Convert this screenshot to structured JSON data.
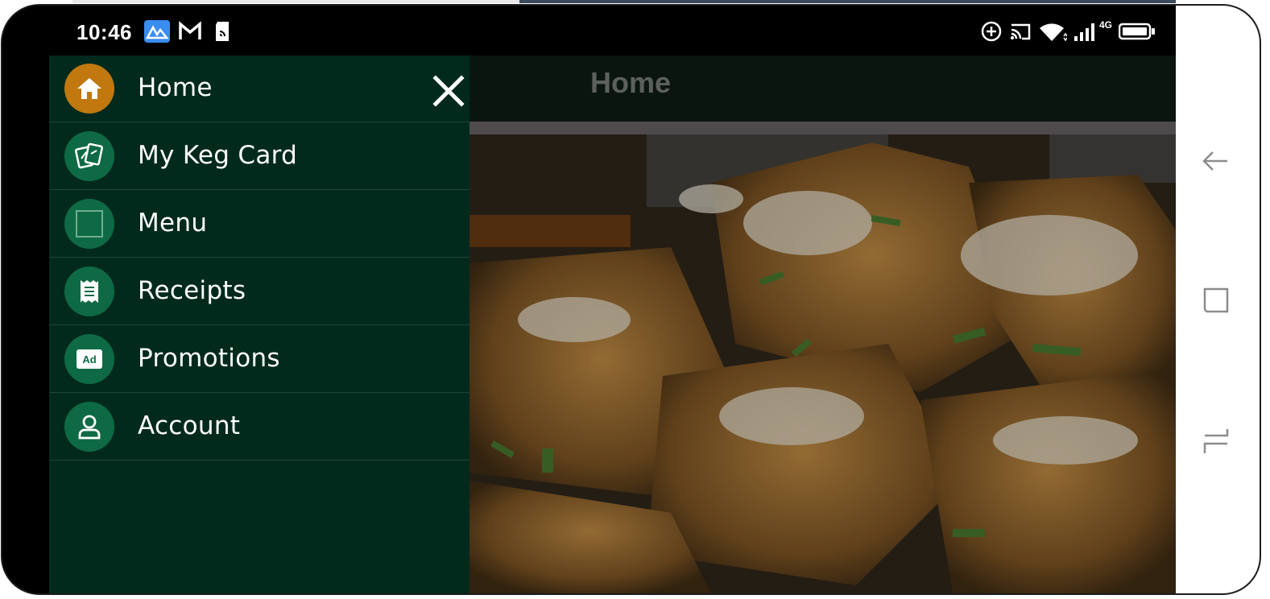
{
  "status_bar": {
    "time": "10:46",
    "left_icons": [
      "maps-app-icon",
      "gmail-icon",
      "sd-card-icon"
    ],
    "right_icons": [
      "data-saver-icon",
      "cast-icon",
      "wifi-icon",
      "signal-icon",
      "battery-icon"
    ],
    "network_label": "4G"
  },
  "app": {
    "title": "Home"
  },
  "drawer": {
    "items": [
      {
        "label": "Home",
        "icon": "home-icon",
        "active": true
      },
      {
        "label": "My Keg Card",
        "icon": "keg-card-icon",
        "active": false
      },
      {
        "label": "Menu",
        "icon": "menu-square-icon",
        "active": false
      },
      {
        "label": "Receipts",
        "icon": "receipt-icon",
        "active": false
      },
      {
        "label": "Promotions",
        "icon": "ad-icon",
        "active": false
      },
      {
        "label": "Account",
        "icon": "account-icon",
        "active": false
      }
    ]
  },
  "system_nav": [
    "back-icon",
    "home-square-icon",
    "recents-icon"
  ],
  "colors": {
    "drawer_bg": "#012a1d",
    "active_icon": "#c1780f",
    "icon_bg": "#0e6a44",
    "app_bar": "#0b1510"
  }
}
